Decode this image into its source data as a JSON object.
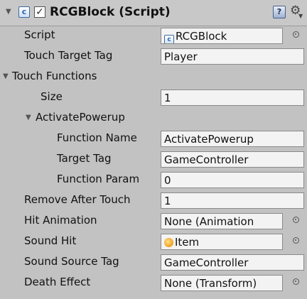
{
  "component": {
    "title": "RCGBlock (Script)",
    "enabled": true,
    "help_icon": "help-book-icon",
    "settings_icon": "gear-icon"
  },
  "fields": {
    "script": {
      "label": "Script",
      "value": "RCGBlock",
      "icon": "script-icon"
    },
    "touch_target_tag": {
      "label": "Touch Target Tag",
      "value": "Player"
    },
    "touch_functions": {
      "label": "Touch Functions",
      "expanded": true
    },
    "size": {
      "label": "Size",
      "value": "1"
    },
    "element": {
      "label": "ActivatePowerup",
      "expanded": true
    },
    "function_name": {
      "label": "Function Name",
      "value": "ActivatePowerup"
    },
    "target_tag": {
      "label": "Target Tag",
      "value": "GameController"
    },
    "function_param": {
      "label": "Function Param",
      "value": "0"
    },
    "remove_after_touch": {
      "label": "Remove After Touch",
      "value": "1"
    },
    "hit_animation": {
      "label": "Hit Animation",
      "value": "None (Animation"
    },
    "sound_hit": {
      "label": "Sound Hit",
      "value": "Item",
      "icon": "audio-clip-icon"
    },
    "sound_source_tag": {
      "label": "Sound Source Tag",
      "value": "GameController"
    },
    "death_effect": {
      "label": "Death Effect",
      "value": "None (Transform)"
    }
  }
}
